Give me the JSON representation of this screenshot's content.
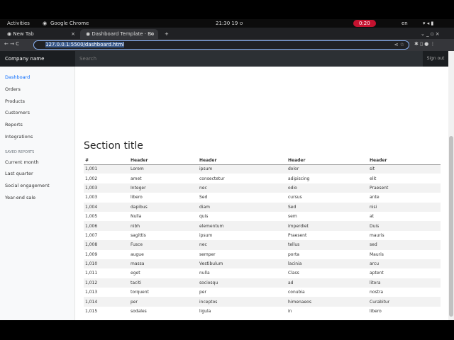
{
  "os": {
    "activities": "Activities",
    "app": "Google Chrome",
    "clock": "ט 19  21:30",
    "recording": "0:20",
    "lang": "en"
  },
  "browser": {
    "tabs": [
      {
        "label": "New Tab"
      },
      {
        "label": "Dashboard Template · Bo"
      }
    ],
    "url": "127.0.0.1:5500/dashboard.html"
  },
  "navbar": {
    "brand": "Company name",
    "search_placeholder": "Search",
    "signout": "Sign out"
  },
  "sidebar": {
    "items": [
      "Dashboard",
      "Orders",
      "Products",
      "Customers",
      "Reports",
      "Integrations"
    ],
    "saved_heading": "SAVED REPORTS",
    "saved": [
      "Current month",
      "Last quarter",
      "Social engagement",
      "Year-end sale"
    ],
    "active_color": "#0d6efd"
  },
  "main": {
    "title": "Section title",
    "headers": [
      "#",
      "Header",
      "Header",
      "Header",
      "Header"
    ],
    "rows": [
      [
        "1,001",
        "Lorem",
        "ipsum",
        "dolor",
        "sit"
      ],
      [
        "1,002",
        "amet",
        "consectetur",
        "adipiscing",
        "elit"
      ],
      [
        "1,003",
        "Integer",
        "nec",
        "odio",
        "Praesent"
      ],
      [
        "1,003",
        "libero",
        "Sed",
        "cursus",
        "ante"
      ],
      [
        "1,004",
        "dapibus",
        "diam",
        "Sed",
        "nisi"
      ],
      [
        "1,005",
        "Nulla",
        "quis",
        "sem",
        "at"
      ],
      [
        "1,006",
        "nibh",
        "elementum",
        "imperdiet",
        "Duis"
      ],
      [
        "1,007",
        "sagittis",
        "ipsum",
        "Praesent",
        "mauris"
      ],
      [
        "1,008",
        "Fusce",
        "nec",
        "tellus",
        "sed"
      ],
      [
        "1,009",
        "augue",
        "semper",
        "porta",
        "Mauris"
      ],
      [
        "1,010",
        "massa",
        "Vestibulum",
        "lacinia",
        "arcu"
      ],
      [
        "1,011",
        "eget",
        "nulla",
        "Class",
        "aptent"
      ],
      [
        "1,012",
        "taciti",
        "sociosqu",
        "ad",
        "litora"
      ],
      [
        "1,013",
        "torquent",
        "per",
        "conubia",
        "nostra"
      ],
      [
        "1,014",
        "per",
        "inceptos",
        "himenaeos",
        "Curabitur"
      ],
      [
        "1,015",
        "sodales",
        "ligula",
        "in",
        "libero"
      ]
    ]
  }
}
